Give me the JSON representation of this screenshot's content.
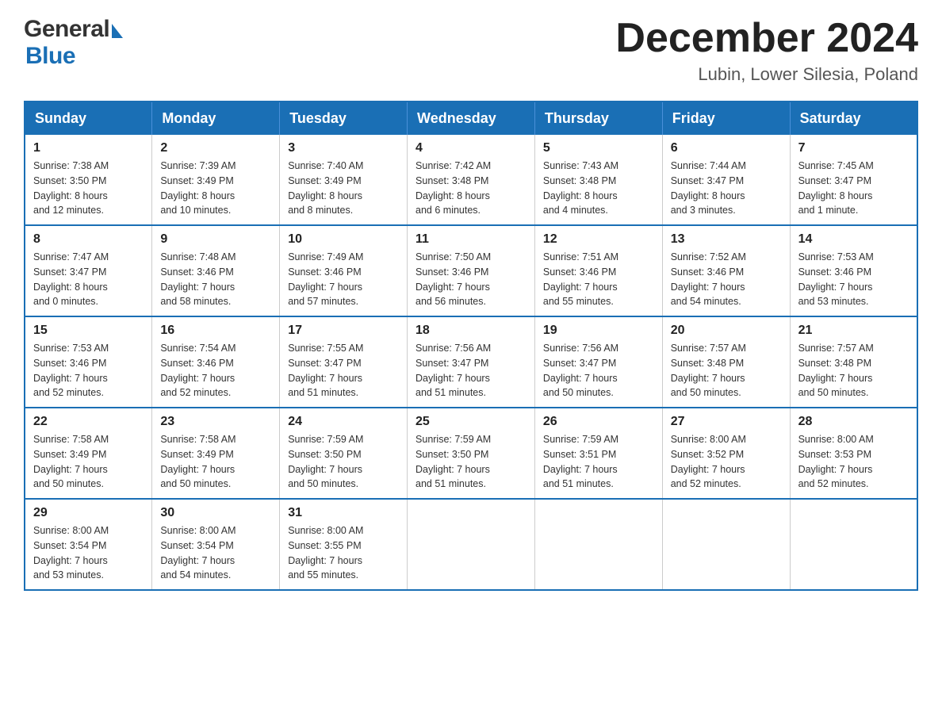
{
  "header": {
    "logo_general": "General",
    "logo_blue": "Blue",
    "month_title": "December 2024",
    "location": "Lubin, Lower Silesia, Poland"
  },
  "days_of_week": [
    "Sunday",
    "Monday",
    "Tuesday",
    "Wednesday",
    "Thursday",
    "Friday",
    "Saturday"
  ],
  "weeks": [
    [
      {
        "num": "1",
        "info": "Sunrise: 7:38 AM\nSunset: 3:50 PM\nDaylight: 8 hours\nand 12 minutes."
      },
      {
        "num": "2",
        "info": "Sunrise: 7:39 AM\nSunset: 3:49 PM\nDaylight: 8 hours\nand 10 minutes."
      },
      {
        "num": "3",
        "info": "Sunrise: 7:40 AM\nSunset: 3:49 PM\nDaylight: 8 hours\nand 8 minutes."
      },
      {
        "num": "4",
        "info": "Sunrise: 7:42 AM\nSunset: 3:48 PM\nDaylight: 8 hours\nand 6 minutes."
      },
      {
        "num": "5",
        "info": "Sunrise: 7:43 AM\nSunset: 3:48 PM\nDaylight: 8 hours\nand 4 minutes."
      },
      {
        "num": "6",
        "info": "Sunrise: 7:44 AM\nSunset: 3:47 PM\nDaylight: 8 hours\nand 3 minutes."
      },
      {
        "num": "7",
        "info": "Sunrise: 7:45 AM\nSunset: 3:47 PM\nDaylight: 8 hours\nand 1 minute."
      }
    ],
    [
      {
        "num": "8",
        "info": "Sunrise: 7:47 AM\nSunset: 3:47 PM\nDaylight: 8 hours\nand 0 minutes."
      },
      {
        "num": "9",
        "info": "Sunrise: 7:48 AM\nSunset: 3:46 PM\nDaylight: 7 hours\nand 58 minutes."
      },
      {
        "num": "10",
        "info": "Sunrise: 7:49 AM\nSunset: 3:46 PM\nDaylight: 7 hours\nand 57 minutes."
      },
      {
        "num": "11",
        "info": "Sunrise: 7:50 AM\nSunset: 3:46 PM\nDaylight: 7 hours\nand 56 minutes."
      },
      {
        "num": "12",
        "info": "Sunrise: 7:51 AM\nSunset: 3:46 PM\nDaylight: 7 hours\nand 55 minutes."
      },
      {
        "num": "13",
        "info": "Sunrise: 7:52 AM\nSunset: 3:46 PM\nDaylight: 7 hours\nand 54 minutes."
      },
      {
        "num": "14",
        "info": "Sunrise: 7:53 AM\nSunset: 3:46 PM\nDaylight: 7 hours\nand 53 minutes."
      }
    ],
    [
      {
        "num": "15",
        "info": "Sunrise: 7:53 AM\nSunset: 3:46 PM\nDaylight: 7 hours\nand 52 minutes."
      },
      {
        "num": "16",
        "info": "Sunrise: 7:54 AM\nSunset: 3:46 PM\nDaylight: 7 hours\nand 52 minutes."
      },
      {
        "num": "17",
        "info": "Sunrise: 7:55 AM\nSunset: 3:47 PM\nDaylight: 7 hours\nand 51 minutes."
      },
      {
        "num": "18",
        "info": "Sunrise: 7:56 AM\nSunset: 3:47 PM\nDaylight: 7 hours\nand 51 minutes."
      },
      {
        "num": "19",
        "info": "Sunrise: 7:56 AM\nSunset: 3:47 PM\nDaylight: 7 hours\nand 50 minutes."
      },
      {
        "num": "20",
        "info": "Sunrise: 7:57 AM\nSunset: 3:48 PM\nDaylight: 7 hours\nand 50 minutes."
      },
      {
        "num": "21",
        "info": "Sunrise: 7:57 AM\nSunset: 3:48 PM\nDaylight: 7 hours\nand 50 minutes."
      }
    ],
    [
      {
        "num": "22",
        "info": "Sunrise: 7:58 AM\nSunset: 3:49 PM\nDaylight: 7 hours\nand 50 minutes."
      },
      {
        "num": "23",
        "info": "Sunrise: 7:58 AM\nSunset: 3:49 PM\nDaylight: 7 hours\nand 50 minutes."
      },
      {
        "num": "24",
        "info": "Sunrise: 7:59 AM\nSunset: 3:50 PM\nDaylight: 7 hours\nand 50 minutes."
      },
      {
        "num": "25",
        "info": "Sunrise: 7:59 AM\nSunset: 3:50 PM\nDaylight: 7 hours\nand 51 minutes."
      },
      {
        "num": "26",
        "info": "Sunrise: 7:59 AM\nSunset: 3:51 PM\nDaylight: 7 hours\nand 51 minutes."
      },
      {
        "num": "27",
        "info": "Sunrise: 8:00 AM\nSunset: 3:52 PM\nDaylight: 7 hours\nand 52 minutes."
      },
      {
        "num": "28",
        "info": "Sunrise: 8:00 AM\nSunset: 3:53 PM\nDaylight: 7 hours\nand 52 minutes."
      }
    ],
    [
      {
        "num": "29",
        "info": "Sunrise: 8:00 AM\nSunset: 3:54 PM\nDaylight: 7 hours\nand 53 minutes."
      },
      {
        "num": "30",
        "info": "Sunrise: 8:00 AM\nSunset: 3:54 PM\nDaylight: 7 hours\nand 54 minutes."
      },
      {
        "num": "31",
        "info": "Sunrise: 8:00 AM\nSunset: 3:55 PM\nDaylight: 7 hours\nand 55 minutes."
      },
      {
        "num": "",
        "info": ""
      },
      {
        "num": "",
        "info": ""
      },
      {
        "num": "",
        "info": ""
      },
      {
        "num": "",
        "info": ""
      }
    ]
  ]
}
